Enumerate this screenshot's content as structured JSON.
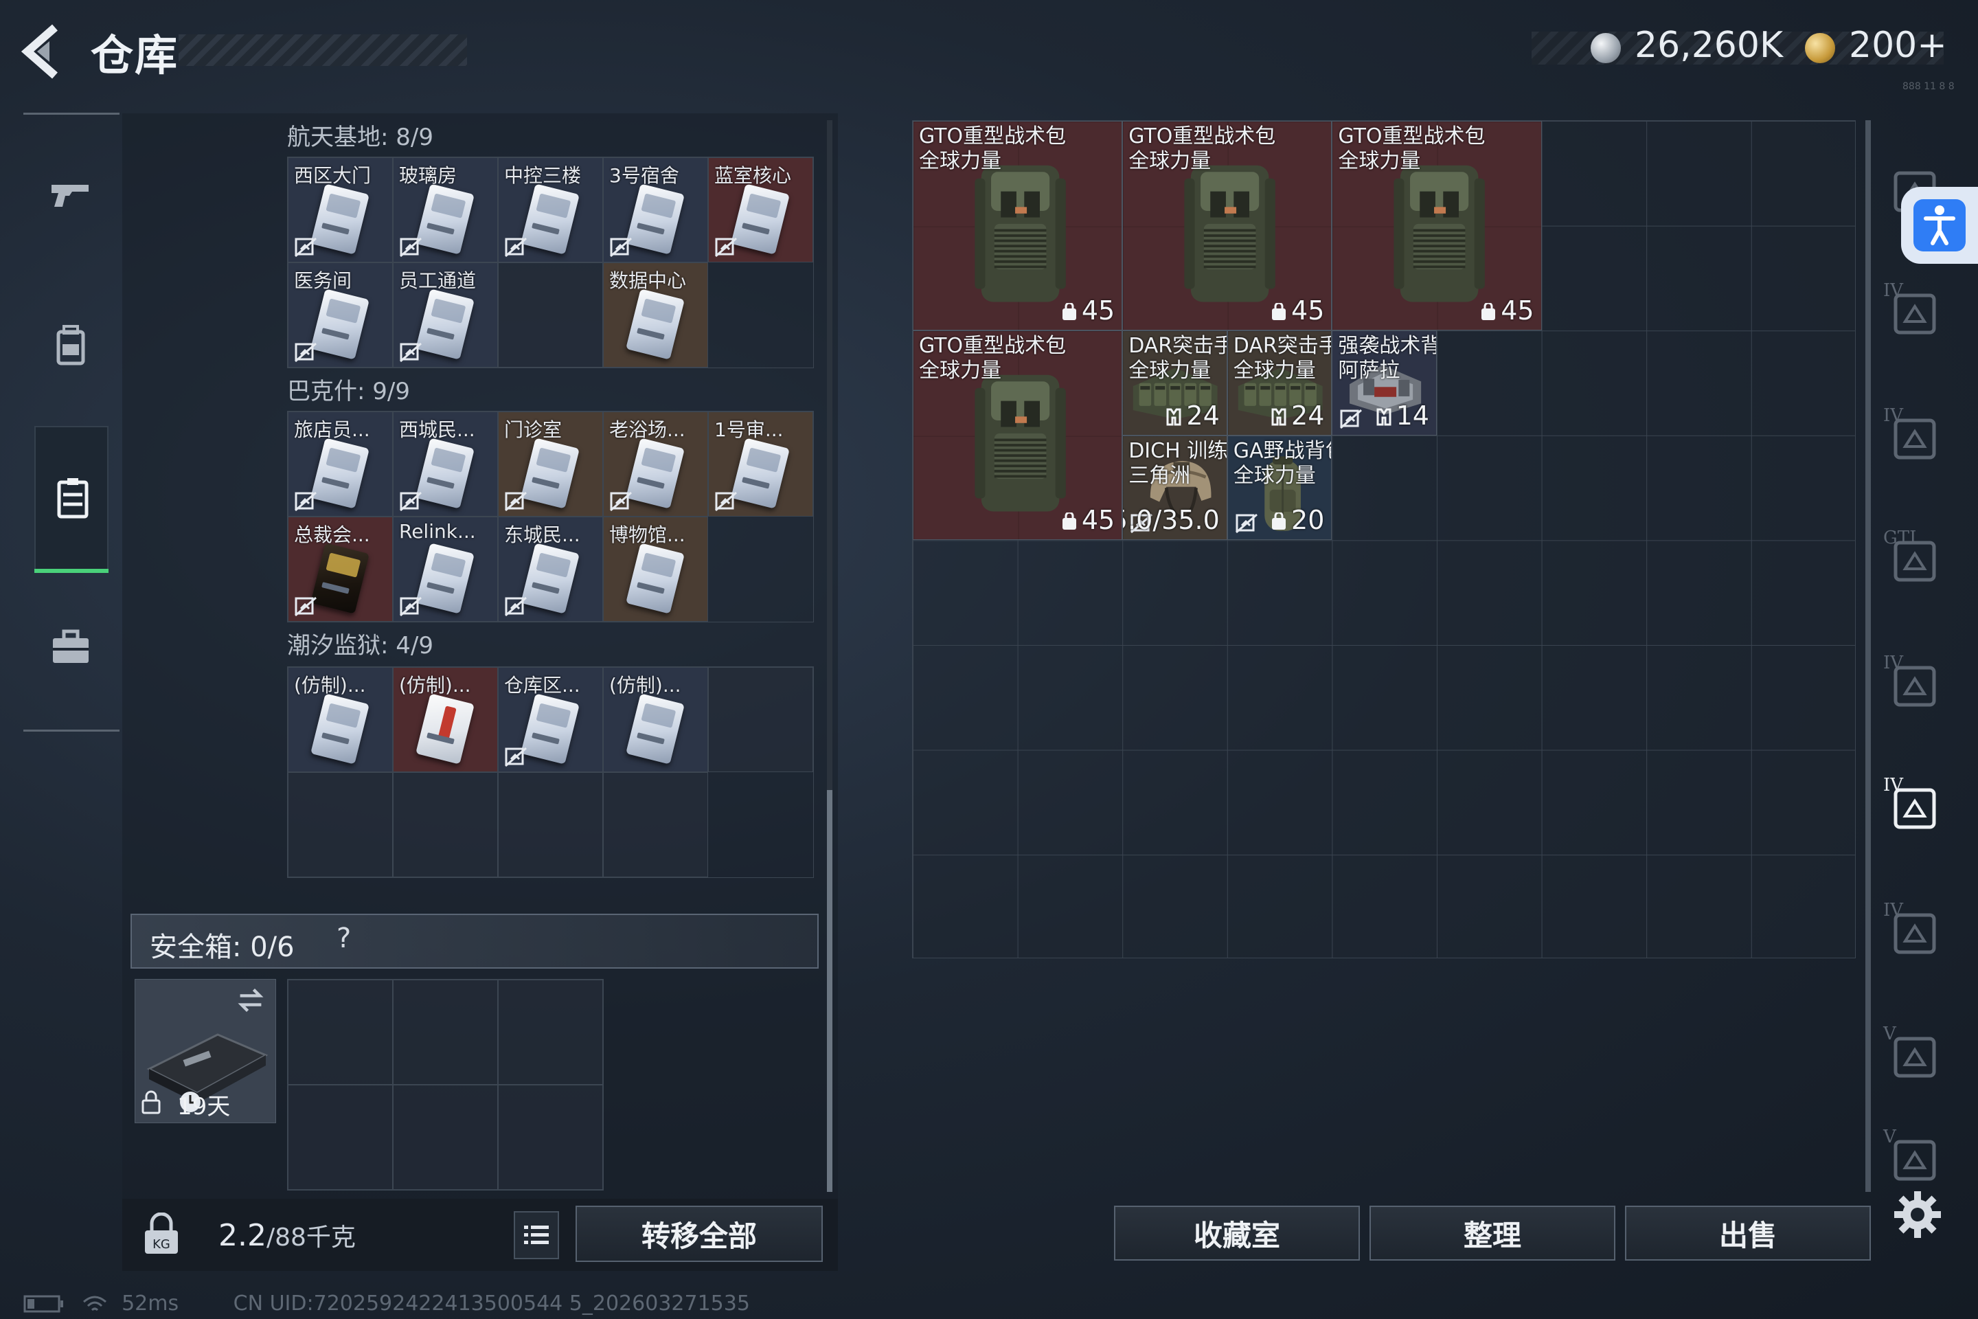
{
  "header": {
    "title": "仓库",
    "currency_silver": "26,260K",
    "currency_gold": "200+",
    "tiny_text": "888 11 8 8"
  },
  "left_rail": [
    "weapon-icon",
    "backpack-icon",
    "storage-icon",
    "briefcase-icon"
  ],
  "keycards": {
    "sections": [
      {
        "title": "航天基地: 8/9",
        "cells": [
          {
            "label": "西区大门",
            "style": "blue",
            "card": "silver",
            "bound": true
          },
          {
            "label": "玻璃房",
            "style": "blue",
            "card": "silver",
            "bound": true
          },
          {
            "label": "中控三楼",
            "style": "blue",
            "card": "silver",
            "bound": true
          },
          {
            "label": "3号宿舍",
            "style": "blue",
            "card": "silver",
            "bound": true
          },
          {
            "label": "蓝室核心",
            "style": "red",
            "card": "silver",
            "bound": true
          },
          {
            "label": "医务间",
            "style": "blue",
            "card": "silver",
            "bound": true
          },
          {
            "label": "员工通道",
            "style": "blue",
            "card": "silver",
            "bound": true
          },
          {
            "label": "",
            "style": "empty",
            "card": "none",
            "bound": false
          },
          {
            "label": "数据中心",
            "style": "gold",
            "card": "silver",
            "bound": false
          }
        ]
      },
      {
        "title": "巴克什: 9/9",
        "cells": [
          {
            "label": "旅店员...",
            "style": "blue",
            "card": "silver",
            "bound": true
          },
          {
            "label": "西城民...",
            "style": "blue",
            "card": "silver",
            "bound": true
          },
          {
            "label": "门诊室",
            "style": "gold",
            "card": "silver",
            "bound": true
          },
          {
            "label": "老浴场...",
            "style": "gold",
            "card": "silver",
            "bound": true
          },
          {
            "label": "1号审...",
            "style": "gold",
            "card": "silver",
            "bound": true
          },
          {
            "label": "总裁会...",
            "style": "red",
            "card": "dark",
            "bound": true
          },
          {
            "label": "Relink...",
            "style": "blue",
            "card": "silver",
            "bound": true
          },
          {
            "label": "东城民...",
            "style": "blue",
            "card": "silver",
            "bound": true
          },
          {
            "label": "博物馆...",
            "style": "gold",
            "card": "silver",
            "bound": false
          }
        ]
      },
      {
        "title": "潮汐监狱: 4/9",
        "cells": [
          {
            "label": "(仿制)...",
            "style": "blue",
            "card": "silver",
            "bound": false
          },
          {
            "label": "(仿制)...",
            "style": "red",
            "card": "redstripe",
            "bound": false
          },
          {
            "label": "仓库区...",
            "style": "blue",
            "card": "silver",
            "bound": true
          },
          {
            "label": "(仿制)...",
            "style": "blue",
            "card": "silver",
            "bound": false
          },
          {
            "label": "",
            "style": "empty",
            "card": "none",
            "bound": false
          },
          {
            "label": "",
            "style": "empty",
            "card": "none",
            "bound": false
          },
          {
            "label": "",
            "style": "empty",
            "card": "none",
            "bound": false
          },
          {
            "label": "",
            "style": "empty",
            "card": "none",
            "bound": false
          },
          {
            "label": "",
            "style": "empty",
            "card": "none",
            "bound": false
          }
        ]
      }
    ]
  },
  "safe_box": {
    "label": "安全箱: 0/6",
    "help": "?",
    "days": "19天"
  },
  "footer_left": {
    "weight_value": "2.2",
    "weight_capacity": "/88千克",
    "transfer_all": "转移全部"
  },
  "stash_items": [
    {
      "name": "GTO重型战术包\n全球力量",
      "value": "45",
      "value_icon": "weight-icon",
      "rarity": "red",
      "art": "backpack",
      "bound": false
    },
    {
      "name": "GTO重型战术包\n全球力量",
      "value": "45",
      "value_icon": "weight-icon",
      "rarity": "red",
      "art": "backpack",
      "bound": false
    },
    {
      "name": "GTO重型战术包\n全球力量",
      "value": "45",
      "value_icon": "weight-icon",
      "rarity": "red",
      "art": "backpack",
      "bound": false
    },
    {
      "name": "GTO重型战术包\n全球力量",
      "value": "45",
      "value_icon": "weight-icon",
      "rarity": "red",
      "art": "backpack",
      "bound": false
    },
    {
      "name": "DAR突击手胸挂\n全球力量",
      "value": "24",
      "value_icon": "vest-icon",
      "rarity": "gold",
      "art": "rig",
      "bound": false
    },
    {
      "name": "DAR突击手胸挂\n全球力量",
      "value": "24",
      "value_icon": "vest-icon",
      "rarity": "gold",
      "art": "rig",
      "bound": false
    },
    {
      "name": "强袭战术背心\n阿萨拉",
      "value": "14",
      "value_icon": "vest-icon",
      "rarity": "purple",
      "art": "vest",
      "bound": true
    },
    {
      "name": "DICH 训练头盔\n三角洲",
      "value": "35.0/35.0",
      "value_icon": "",
      "rarity": "gold",
      "art": "helmet",
      "bound": true
    },
    {
      "name": "GA野战背包\n全球力量",
      "value": "20",
      "value_icon": "weight-icon",
      "rarity": "blue",
      "art": "duffel",
      "bound": true
    }
  ],
  "right_rail": {
    "labels": [
      "",
      "IV",
      "IV",
      "GTI",
      "IV",
      "IV",
      "IV",
      "V",
      "V"
    ]
  },
  "footer_right": {
    "collection": "收藏室",
    "organize": "整理",
    "sell": "出售"
  },
  "status_bar": {
    "ping": "52ms",
    "uid": "CN UID:7202592422413500544 5_202603271535"
  },
  "colors": {
    "rarity_red": "#4b2a2e",
    "rarity_gold": "#413a33",
    "rarity_purple": "#2d3346",
    "rarity_blue": "#263547",
    "accent_green": "#4ad17a",
    "accessibility_blue": "#2f7df5"
  }
}
